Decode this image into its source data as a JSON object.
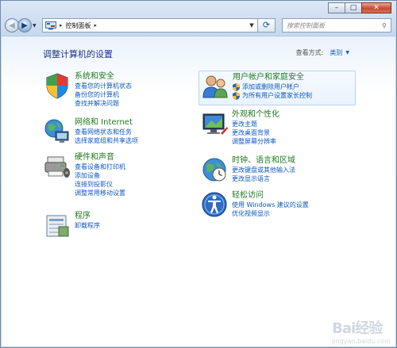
{
  "window": {
    "controls": {
      "minimize": "–",
      "maximize": "□",
      "close": "✕"
    }
  },
  "nav": {
    "back_icon": "back-arrow-icon",
    "forward_icon": "forward-arrow-icon",
    "breadcrumb": [
      "控制面板"
    ],
    "separator": "▸",
    "search_placeholder": "搜索控制面板"
  },
  "header": {
    "title": "调整计算机的设置",
    "view_by_label": "查看方式:",
    "view_by_value": "类别"
  },
  "categories": [
    {
      "title": "系统和安全",
      "icon": "system-security-icon",
      "links": [
        "查看您的计算机状态",
        "备份您的计算机",
        "查找并解决问题"
      ]
    },
    {
      "title": "网络和 Internet",
      "icon": "network-icon",
      "links": [
        "查看网络状态和任务",
        "选择家庭组和共享选项"
      ]
    },
    {
      "title": "硬件和声音",
      "icon": "hardware-sound-icon",
      "links": [
        "查看设备和打印机",
        "添加设备",
        "连接到投影仪",
        "调整常用移动设置"
      ]
    },
    {
      "title": "程序",
      "icon": "programs-icon",
      "links": [
        "卸载程序"
      ]
    },
    {
      "title": "用户帐户和家庭安全",
      "icon": "user-accounts-icon",
      "links": [
        "添加或删除用户帐户",
        "为所有用户设置家长控制"
      ]
    },
    {
      "title": "外观和个性化",
      "icon": "appearance-icon",
      "links": [
        "更改主题",
        "更改桌面背景",
        "调整屏幕分辨率"
      ]
    },
    {
      "title": "时钟、语言和区域",
      "icon": "clock-language-region-icon",
      "links": [
        "更改键盘或其他输入法",
        "更改显示语言"
      ]
    },
    {
      "title": "轻松访问",
      "icon": "ease-of-access-icon",
      "links": [
        "使用 Windows 建议的设置",
        "优化视频显示"
      ]
    }
  ],
  "watermark": {
    "brand": "Bai经验",
    "sub": "jingyan.baidu.com"
  }
}
